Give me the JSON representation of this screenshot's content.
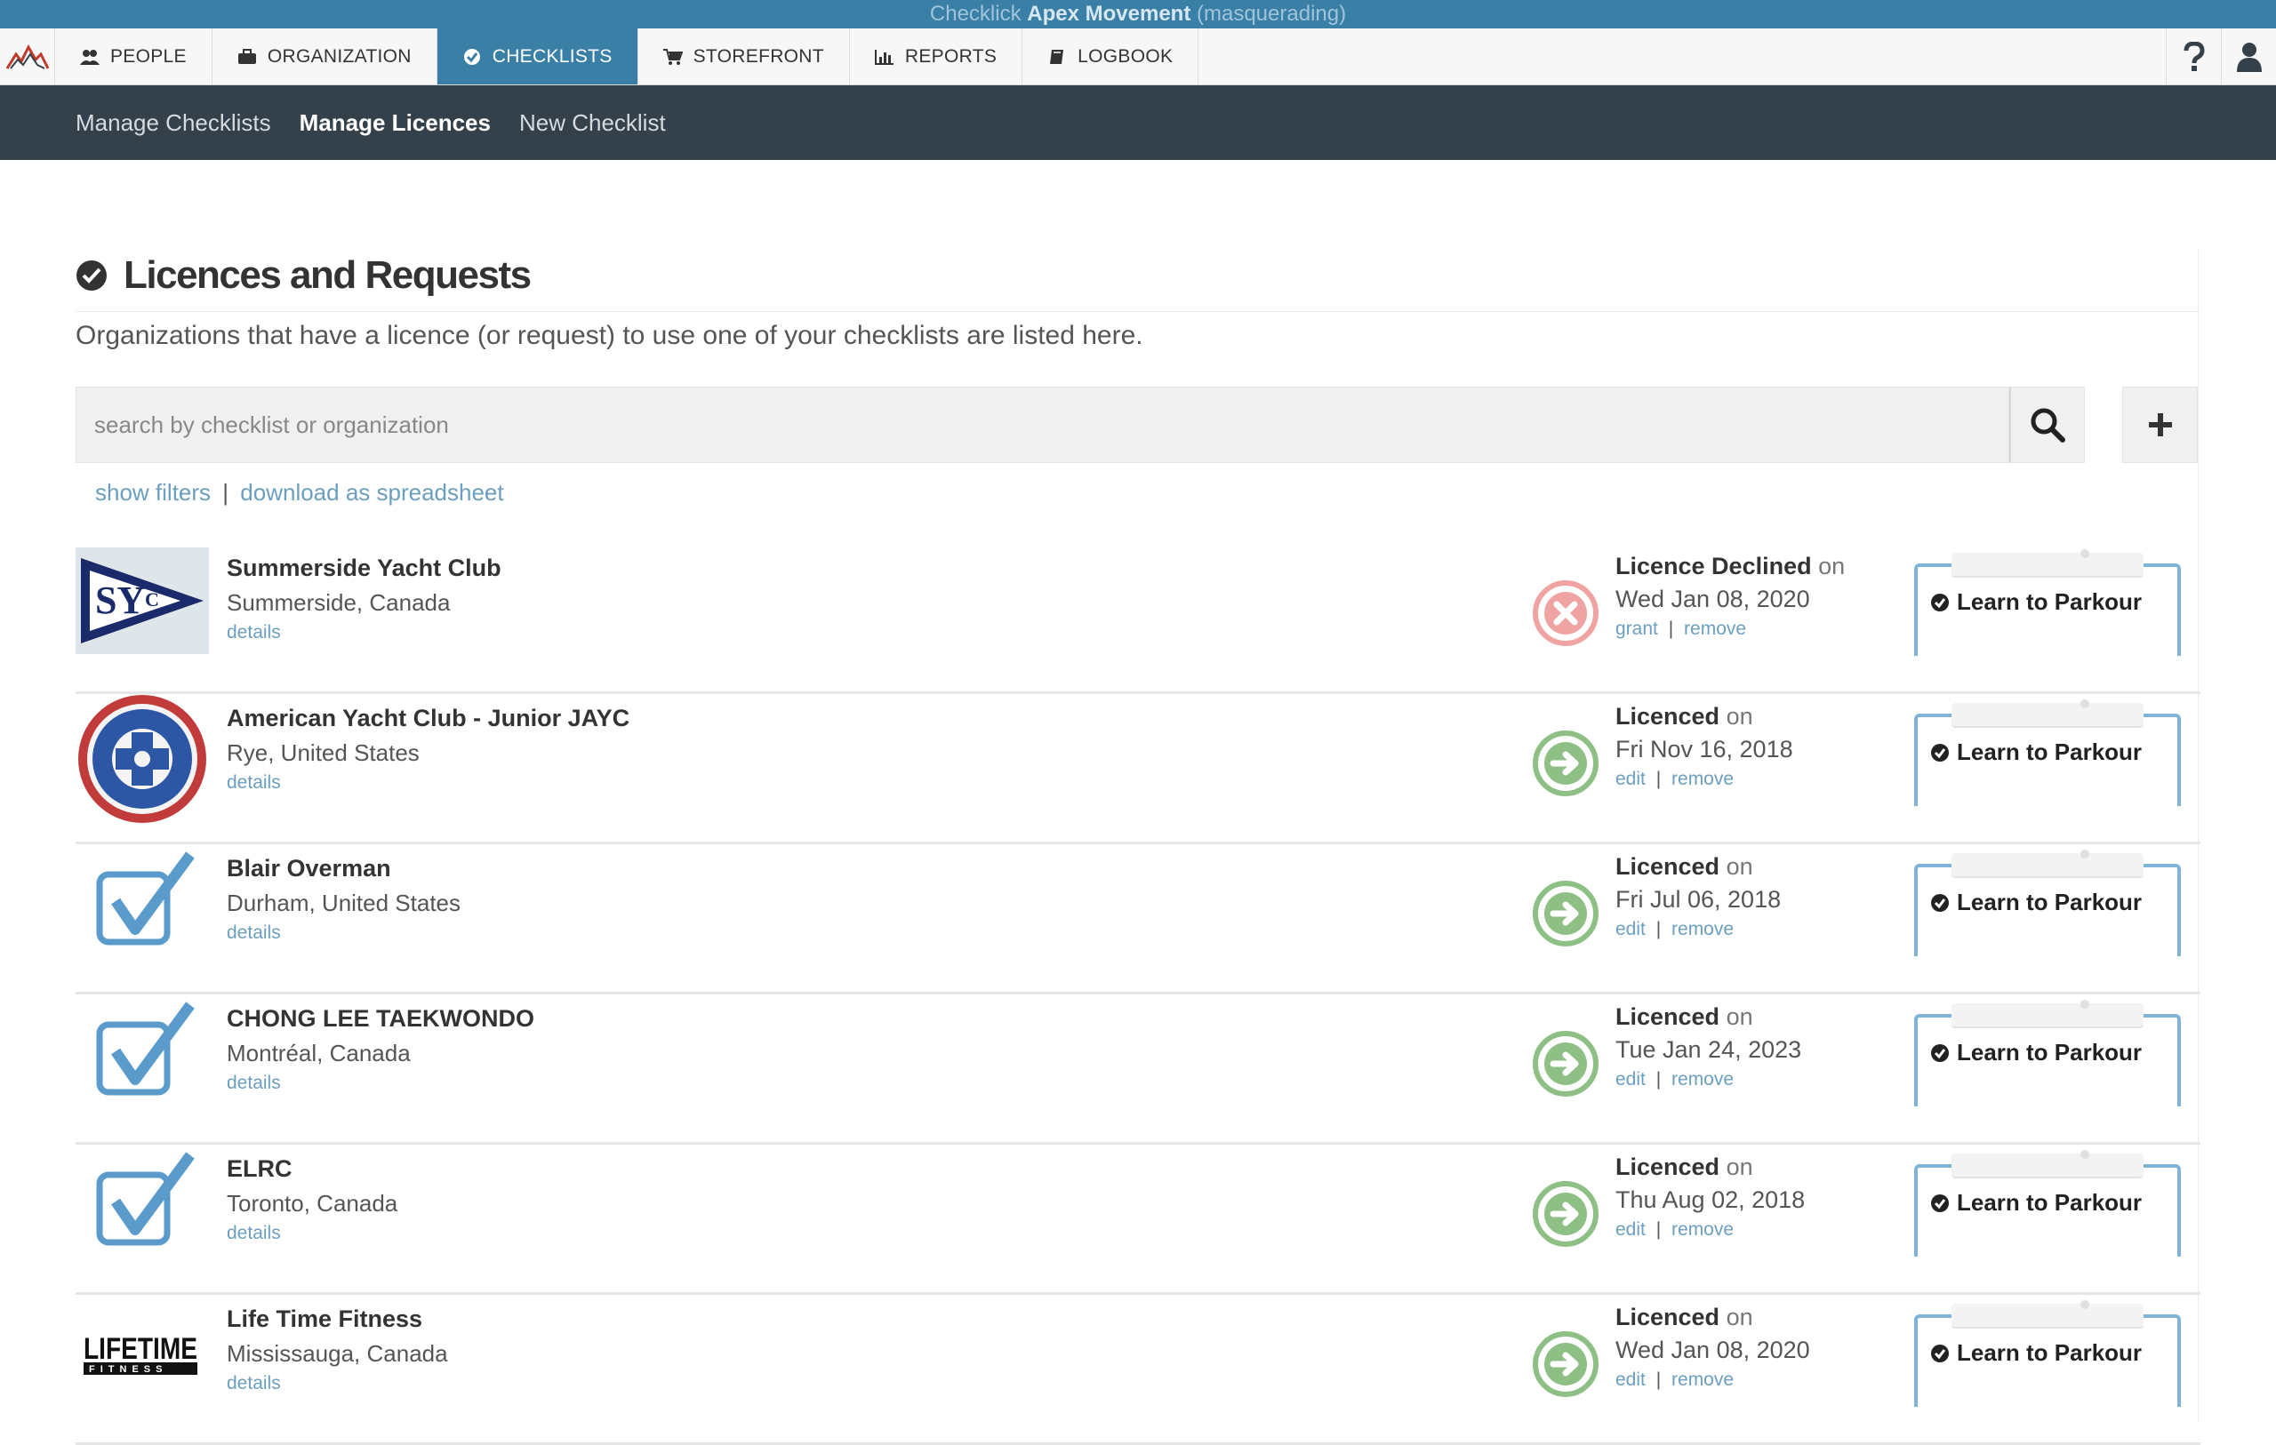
{
  "masquerade": {
    "prefix": "Checklick",
    "org": "Apex Movement",
    "suffix": "(masquerading)"
  },
  "nav": {
    "items": [
      {
        "label": "PEOPLE",
        "icon": "people-icon"
      },
      {
        "label": "ORGANIZATION",
        "icon": "briefcase-icon"
      },
      {
        "label": "CHECKLISTS",
        "icon": "check-circle-icon",
        "active": true
      },
      {
        "label": "STOREFRONT",
        "icon": "cart-icon"
      },
      {
        "label": "REPORTS",
        "icon": "bar-chart-icon"
      },
      {
        "label": "LOGBOOK",
        "icon": "book-icon"
      }
    ],
    "help_icon": "question-icon",
    "user_icon": "user-icon"
  },
  "subnav": {
    "items": [
      "Manage Checklists",
      "Manage Licences",
      "New Checklist"
    ],
    "active": "Manage Licences"
  },
  "page": {
    "title": "Licences and Requests",
    "description": "Organizations that have a licence (or request) to use one of your checklists are listed here.",
    "search_placeholder": "search by checklist or organization",
    "show_filters": "show filters",
    "download": "download as spreadsheet"
  },
  "rows": [
    {
      "name": "Summerside Yacht Club",
      "location": "Summerside, Canada",
      "details": "details",
      "status": "Licence Declined",
      "on": "on",
      "date": "Wed Jan 08, 2020",
      "action1": "grant",
      "action2": "remove",
      "state": "declined",
      "checklist": "Learn to Parkour",
      "thumb": "syc-flag"
    },
    {
      "name": "American Yacht Club - Junior JAYC",
      "location": "Rye, United States",
      "details": "details",
      "status": "Licenced",
      "on": "on",
      "date": "Fri Nov 16, 2018",
      "action1": "edit",
      "action2": "remove",
      "state": "licenced",
      "checklist": "Learn to Parkour",
      "thumb": "ayc-seal"
    },
    {
      "name": "Blair Overman",
      "location": "Durham, United States",
      "details": "details",
      "status": "Licenced",
      "on": "on",
      "date": "Fri Jul 06, 2018",
      "action1": "edit",
      "action2": "remove",
      "state": "licenced",
      "checklist": "Learn to Parkour",
      "thumb": "checkbox"
    },
    {
      "name": "CHONG LEE TAEKWONDO",
      "location": "Montréal, Canada",
      "details": "details",
      "status": "Licenced",
      "on": "on",
      "date": "Tue Jan 24, 2023",
      "action1": "edit",
      "action2": "remove",
      "state": "licenced",
      "checklist": "Learn to Parkour",
      "thumb": "checkbox"
    },
    {
      "name": "ELRC",
      "location": "Toronto, Canada",
      "details": "details",
      "status": "Licenced",
      "on": "on",
      "date": "Thu Aug 02, 2018",
      "action1": "edit",
      "action2": "remove",
      "state": "licenced",
      "checklist": "Learn to Parkour",
      "thumb": "checkbox"
    },
    {
      "name": "Life Time Fitness",
      "location": "Mississauga, Canada",
      "details": "details",
      "status": "Licenced",
      "on": "on",
      "date": "Wed Jan 08, 2020",
      "action1": "edit",
      "action2": "remove",
      "state": "licenced",
      "checklist": "Learn to Parkour",
      "thumb": "lifetime"
    }
  ],
  "colors": {
    "accent": "#3a7fa6",
    "subnav": "#34414a",
    "link": "#6b9fc0",
    "licenced": "#8ebf85",
    "declined": "#f0a3a3",
    "clip": "#7fb4d6"
  }
}
